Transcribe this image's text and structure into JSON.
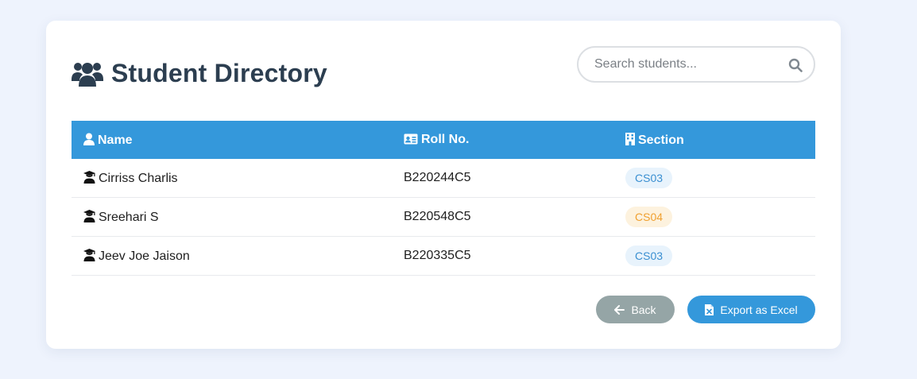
{
  "header": {
    "title": "Student Directory",
    "title_icon": "users-icon"
  },
  "search": {
    "placeholder": "Search students...",
    "value": "",
    "icon": "search-icon"
  },
  "table": {
    "columns": [
      {
        "label": "Name",
        "icon": "user-icon"
      },
      {
        "label": "Roll No.",
        "icon": "id-card-icon"
      },
      {
        "label": "Section",
        "icon": "building-icon"
      }
    ],
    "rows": [
      {
        "name": "Cirriss Charlis",
        "roll": "B220244C5",
        "section": "CS03",
        "section_color": "blue"
      },
      {
        "name": "Sreehari S",
        "roll": "B220548C5",
        "section": "CS04",
        "section_color": "orange"
      },
      {
        "name": "Jeev Joe Jaison",
        "roll": "B220335C5",
        "section": "CS03",
        "section_color": "blue"
      }
    ],
    "row_icon": "graduate-icon"
  },
  "actions": {
    "back_label": "Back",
    "export_label": "Export as Excel"
  },
  "colors": {
    "accent": "#3498db",
    "title": "#2c3e50",
    "back_button": "#95a5a6",
    "badge_blue_bg": "#e8f3fc",
    "badge_blue_text": "#3a8fd1",
    "badge_orange_bg": "#fdf2de",
    "badge_orange_text": "#f0a030",
    "page_background": "#eef3fd"
  }
}
